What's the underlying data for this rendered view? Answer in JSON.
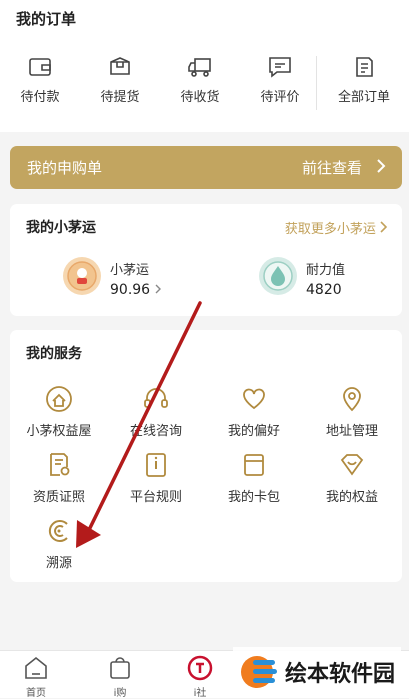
{
  "orders": {
    "title": "我的订单",
    "items": [
      {
        "label": "待付款",
        "icon": "wallet-icon"
      },
      {
        "label": "待提货",
        "icon": "package-icon"
      },
      {
        "label": "待收货",
        "icon": "truck-icon"
      },
      {
        "label": "待评价",
        "icon": "comment-icon"
      }
    ],
    "all": {
      "label": "全部订单",
      "icon": "order-list-icon"
    }
  },
  "apply": {
    "label": "我的申购单",
    "action": "前往查看"
  },
  "luck": {
    "title": "我的小茅运",
    "more": "获取更多小茅运",
    "stats": [
      {
        "label": "小茅运",
        "value": "90.96"
      },
      {
        "label": "耐力值",
        "value": "4820"
      }
    ]
  },
  "services": {
    "title": "我的服务",
    "items": [
      {
        "label": "小茅权益屋",
        "icon": "house-icon"
      },
      {
        "label": "在线咨询",
        "icon": "headset-icon"
      },
      {
        "label": "我的偏好",
        "icon": "heart-icon"
      },
      {
        "label": "地址管理",
        "icon": "location-pin-icon"
      },
      {
        "label": "资质证照",
        "icon": "certificate-icon"
      },
      {
        "label": "平台规则",
        "icon": "rules-icon"
      },
      {
        "label": "我的卡包",
        "icon": "card-icon"
      },
      {
        "label": "我的权益",
        "icon": "benefit-icon"
      },
      {
        "label": "溯源",
        "icon": "trace-icon"
      }
    ]
  },
  "tabbar": {
    "items": [
      {
        "label": "首页"
      },
      {
        "label": "i购"
      },
      {
        "label": "i社"
      }
    ]
  },
  "watermark": {
    "text": "绘本软件园"
  },
  "colors": {
    "gold": "#c2a560",
    "arrow": "#b31b1b"
  }
}
